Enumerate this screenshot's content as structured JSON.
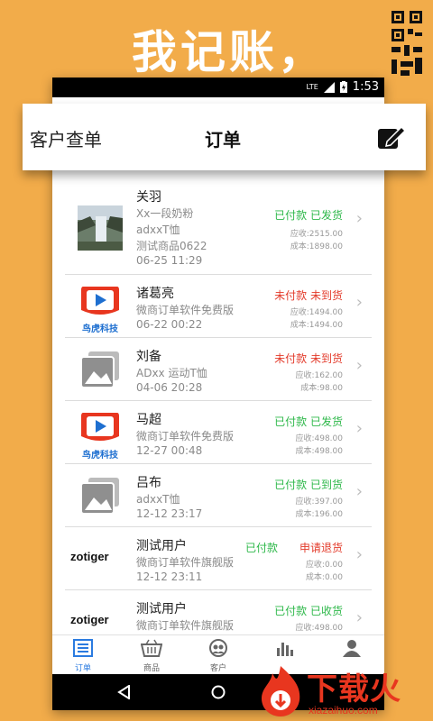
{
  "promo": {
    "headline": "我记账，"
  },
  "status_bar": {
    "network": "LTE",
    "time": "1:53"
  },
  "app_bar": {
    "left_label": "客户查单",
    "title": "订单",
    "edit_icon": "edit-icon"
  },
  "orders": [
    {
      "customer": "关羽",
      "product": "Xx一段奶粉",
      "line2": "adxxT恤",
      "line3": "测试商品0622",
      "date": "06-25 11:29",
      "status": "已付款 已发货",
      "status_color": "green",
      "receivable": "应收:2515.00",
      "cost": "成本:1898.00",
      "thumb": "waterfall-photo"
    },
    {
      "customer": "诸葛亮",
      "product": "微商订单软件免费版",
      "line2": "",
      "line3": "",
      "date": "06-22 00:22",
      "status": "未付款 未到货",
      "status_color": "red",
      "receivable": "应收:1494.00",
      "cost": "成本:1494.00",
      "thumb": "brand-logo"
    },
    {
      "customer": "刘备",
      "product": "ADxx 运动T恤",
      "line2": "",
      "line3": "",
      "date": "04-06 20:28",
      "status": "未付款 未到货",
      "status_color": "red",
      "receivable": "应收:162.00",
      "cost": "成本:98.00",
      "thumb": "image-placeholder"
    },
    {
      "customer": "马超",
      "product": "微商订单软件免费版",
      "line2": "",
      "line3": "",
      "date": "12-27 00:48",
      "status": "已付款 已发货",
      "status_color": "green",
      "receivable": "应收:498.00",
      "cost": "成本:498.00",
      "thumb": "brand-logo"
    },
    {
      "customer": "吕布",
      "product": "adxxT恤",
      "line2": "",
      "line3": "",
      "date": "12-12 23:17",
      "status": "已付款 已到货",
      "status_color": "green",
      "receivable": "应收:397.00",
      "cost": "成本:196.00",
      "thumb": "image-placeholder"
    },
    {
      "customer": "测试用户",
      "product": "微商订单软件旗舰版",
      "line2": "",
      "line3": "",
      "date": "12-12 23:11",
      "status": "已付款",
      "status2": "申请退货",
      "status_color": "green",
      "receivable": "应收:0.00",
      "cost": "成本:0.00",
      "thumb": "zotiger",
      "thumb_text": "zotiger"
    },
    {
      "customer": "测试用户",
      "product": "微商订单软件旗舰版",
      "line2": "",
      "line3": "",
      "date": "12-12 16:30",
      "status": "已付款 已收货",
      "status_color": "green",
      "receivable": "应收:498.00",
      "cost": "成本:0.00",
      "thumb": "zotiger",
      "thumb_text": "zotiger"
    }
  ],
  "tabs": [
    {
      "label": "订单",
      "icon": "order-list-icon",
      "active": true
    },
    {
      "label": "商品",
      "icon": "basket-icon",
      "active": false
    },
    {
      "label": "客户",
      "icon": "customers-icon",
      "active": false
    },
    {
      "label": "",
      "icon": "bar-chart-icon",
      "active": false
    },
    {
      "label": "",
      "icon": "profile-icon",
      "active": false
    }
  ],
  "brand_logo_text": "鸟虎科技",
  "watermark": {
    "text": "下载火",
    "url": "xiazaihuo.com"
  },
  "colors": {
    "background": "#f2ac4a",
    "paid": "#2eb84a",
    "unpaid": "#e33a2a",
    "accent": "#2b7be0"
  }
}
